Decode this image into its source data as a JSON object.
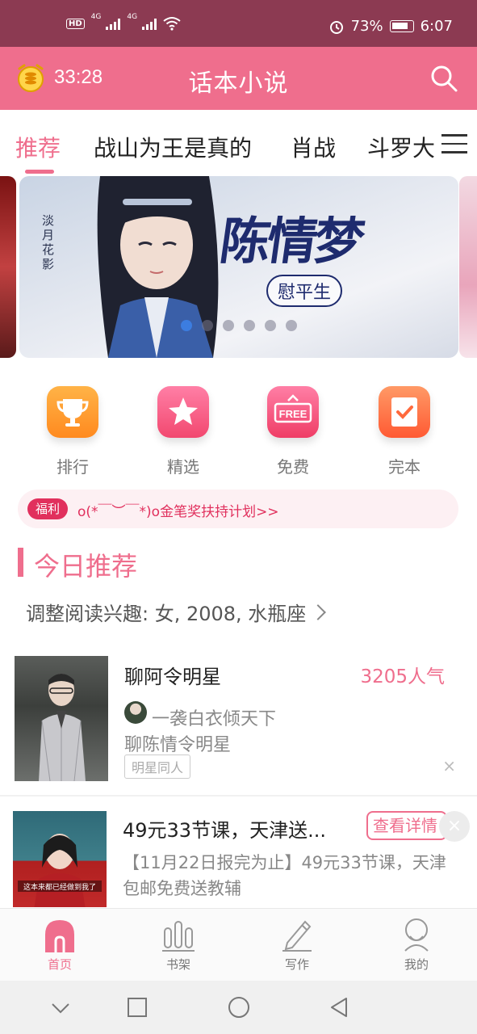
{
  "status_bar": {
    "hd_label": "HD",
    "network_1": "4G",
    "network_2": "4G",
    "battery_percent": "73%",
    "time": "6:07"
  },
  "header": {
    "timer": "33:28",
    "title": "话本小说"
  },
  "tabs": [
    {
      "label": "推荐",
      "active": true
    },
    {
      "label": "战山为王是真的",
      "active": false
    },
    {
      "label": "肖战",
      "active": false
    },
    {
      "label": "斗罗大",
      "active": false
    }
  ],
  "banner": {
    "author_vertical": "淡月花影",
    "title": "陈情梦",
    "subtitle": "慰平生",
    "dot_count": 6,
    "active_dot": 0
  },
  "quick_nav": [
    {
      "label": "排行",
      "icon": "trophy-icon",
      "color_from": "#ffb347",
      "color_to": "#ff8a1f"
    },
    {
      "label": "精选",
      "icon": "star-icon",
      "color_from": "#ff7fa6",
      "color_to": "#f2486f"
    },
    {
      "label": "免费",
      "icon": "free-sign-icon",
      "color_from": "#ff7fa6",
      "color_to": "#ef3d66"
    },
    {
      "label": "完本",
      "icon": "check-book-icon",
      "color_from": "#ff9a66",
      "color_to": "#ff5a33"
    }
  ],
  "promo": {
    "badge": "福利",
    "text": "o(*￣︶￣*)o金笔奖扶持计划>>"
  },
  "section": {
    "title": "今日推荐",
    "interest": "调整阅读兴趣: 女, 2008, 水瓶座"
  },
  "book": {
    "title": "聊阿令明星",
    "popularity": "3205人气",
    "author": "一袭白衣倾天下",
    "description": "聊陈情令明星",
    "tag": "明星同人",
    "dismiss": "×"
  },
  "ad": {
    "title": "49元33节课，天津送...",
    "button": "查看详情",
    "close": "×",
    "description": "【11月22日报完为止】49元33节课，天津包邮免费送教辅",
    "thumb_caption": "这本来都已经做到我了"
  },
  "bottom_nav": [
    {
      "label": "首页",
      "icon": "home-icon",
      "active": true
    },
    {
      "label": "书架",
      "icon": "bookshelf-icon",
      "active": false
    },
    {
      "label": "写作",
      "icon": "pen-icon",
      "active": false
    },
    {
      "label": "我的",
      "icon": "profile-icon",
      "active": false
    }
  ],
  "colors": {
    "brand": "#ef6e8d",
    "status_bar": "#8c3a52",
    "promo_red": "#e1305d"
  }
}
